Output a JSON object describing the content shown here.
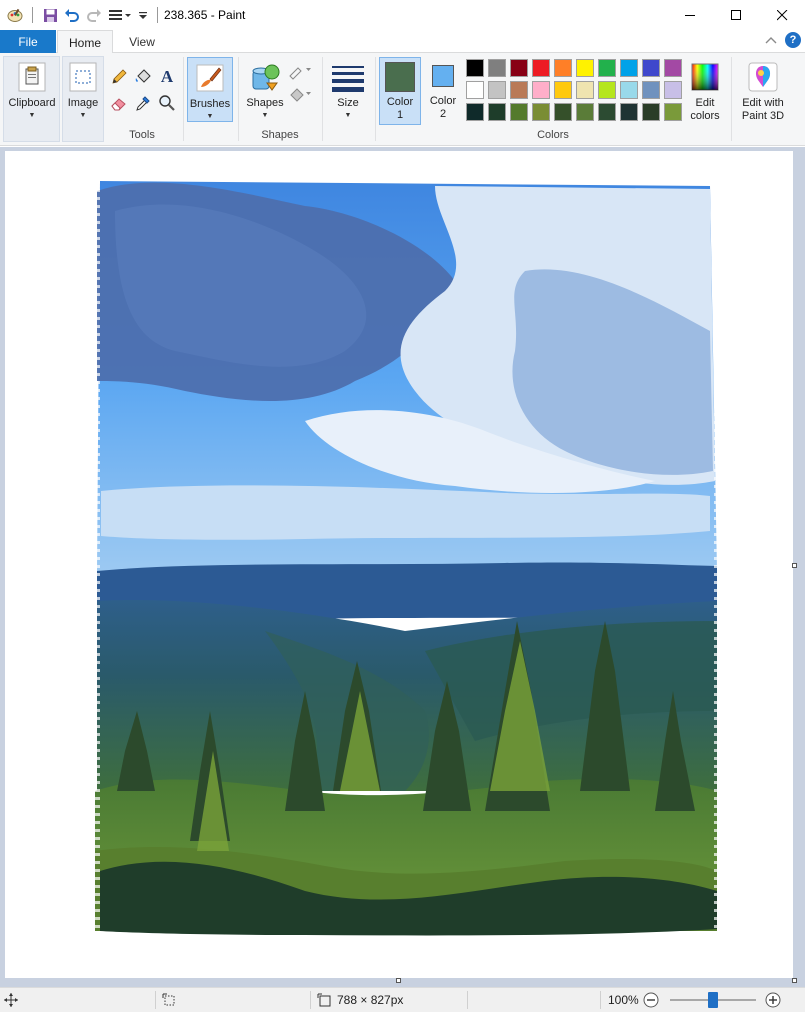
{
  "window": {
    "title": "238.365 - Paint",
    "minimize_glyph": "—",
    "maximize_glyph": "☐",
    "close_glyph": "✕"
  },
  "qat": {
    "icons": [
      "paint-app-icon",
      "save-icon",
      "undo-icon",
      "redo-icon",
      "properties-icon",
      "customize-qat-icon"
    ]
  },
  "tabs": {
    "file": "File",
    "home": "Home",
    "view": "View",
    "collapse_glyph": "^",
    "help_glyph": "?"
  },
  "ribbon": {
    "clipboard": {
      "label": "Clipboard"
    },
    "image": {
      "label": "Image"
    },
    "tools": {
      "label": "Tools",
      "items": [
        "pencil-icon",
        "fill-icon",
        "text-icon",
        "eraser-icon",
        "color-picker-icon",
        "magnifier-icon"
      ]
    },
    "brushes": {
      "label": "Brushes"
    },
    "shapes": {
      "label": "Shapes",
      "group_label": "Shapes"
    },
    "size": {
      "label": "Size"
    },
    "color1": {
      "label_line1": "Color",
      "label_line2": "1",
      "color": "#4a6e4e"
    },
    "color2": {
      "label_line1": "Color",
      "label_line2": "2",
      "color": "#64b0f0"
    },
    "colors_group_label": "Colors",
    "edit_colors": {
      "line1": "Edit",
      "line2": "colors"
    },
    "paint3d": {
      "line1": "Edit with",
      "line2": "Paint 3D"
    },
    "palette_row1": [
      "#000000",
      "#7f7f7f",
      "#880015",
      "#ed1c24",
      "#ff7f27",
      "#fff200",
      "#22b14c",
      "#00a2e8",
      "#3f48cc",
      "#a349a4"
    ],
    "palette_row2": [
      "#ffffff",
      "#c3c3c3",
      "#b97a57",
      "#ffaec9",
      "#ffc90e",
      "#efe4b0",
      "#b5e61d",
      "#99d9ea",
      "#7092be",
      "#c8bfe7"
    ],
    "palette_row3": [
      "#0f2a2a",
      "#1e3d2a",
      "#547a2c",
      "#7a8d34",
      "#35502a",
      "#5a7c38",
      "#2c4b32",
      "#1f3333",
      "#2a3d28",
      "#7a9a3a"
    ]
  },
  "status": {
    "dimensions": "788 × 827px",
    "zoom": "100%",
    "zoom_level": 0.5
  }
}
